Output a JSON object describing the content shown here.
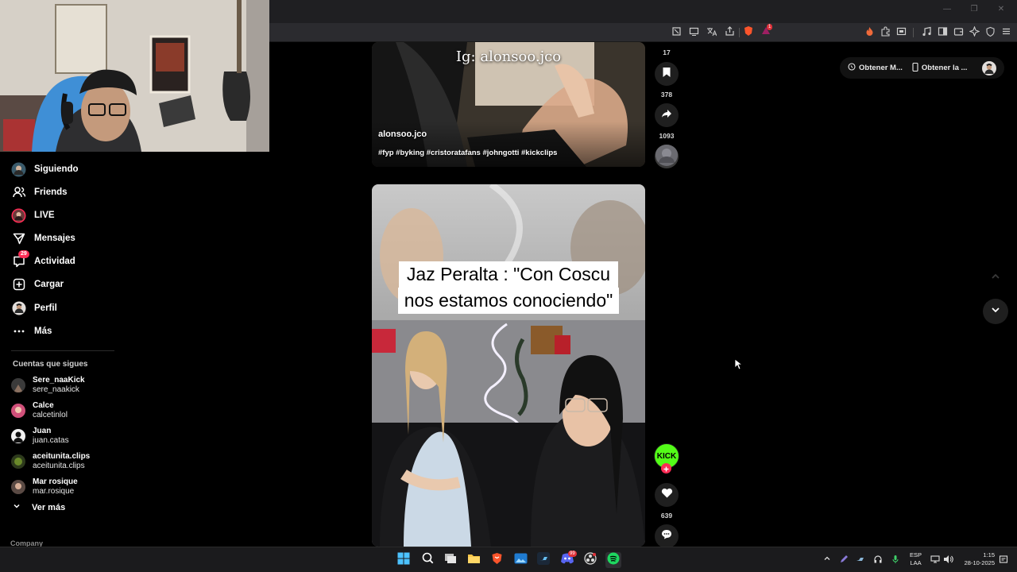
{
  "browser": {
    "window_controls": [
      "—",
      "❐",
      "✕"
    ],
    "notification_badge": "1",
    "brave_badge": "8"
  },
  "sidebar": {
    "nav": [
      {
        "label": "Siguiendo",
        "icon": "following-icon"
      },
      {
        "label": "Friends",
        "icon": "friends-icon"
      },
      {
        "label": "LIVE",
        "icon": "live-icon"
      },
      {
        "label": "Mensajes",
        "icon": "messages-icon"
      },
      {
        "label": "Actividad",
        "icon": "activity-icon",
        "badge": "29"
      },
      {
        "label": "Cargar",
        "icon": "upload-icon"
      },
      {
        "label": "Perfil",
        "icon": "profile-icon"
      },
      {
        "label": "Más",
        "icon": "more-icon"
      }
    ],
    "following_title": "Cuentas que sigues",
    "accounts": [
      {
        "name": "Sere_naaKick",
        "handle": "sere_naakick"
      },
      {
        "name": "Calce",
        "handle": "calcetinlol"
      },
      {
        "name": "Juan",
        "handle": "juan.catas"
      },
      {
        "name": "aceitunita.clips",
        "handle": "aceitunita.clips"
      },
      {
        "name": "Mar rosique",
        "handle": "mar.rosique"
      }
    ],
    "see_more": "Ver más",
    "footer_section": "Company"
  },
  "video1": {
    "overlay_text": "Ig: alonsoo.jco",
    "author": "alonsoo.jco",
    "hashtags": "#fyp #byking #cristoratafans #johngotti #kickclips",
    "counts": {
      "top": "17",
      "saves": "378",
      "shares": "1093"
    }
  },
  "video2": {
    "caption_line1": "Jaz Peralta : \"Con Coscu",
    "caption_line2": "nos estamos conociendo\"",
    "badge": "KICK",
    "likes": "639"
  },
  "top_pill": {
    "button1": "Obtener M...",
    "button2": "Obtener la ..."
  },
  "taskbar": {
    "lang_line1": "ESP",
    "lang_line2": "LAA",
    "time": "1:15",
    "date": "28-10-2025",
    "discord_badge": "99"
  },
  "colors": {
    "accent_red": "#fe2c55",
    "kick_green": "#53fc18",
    "background": "#000000"
  }
}
